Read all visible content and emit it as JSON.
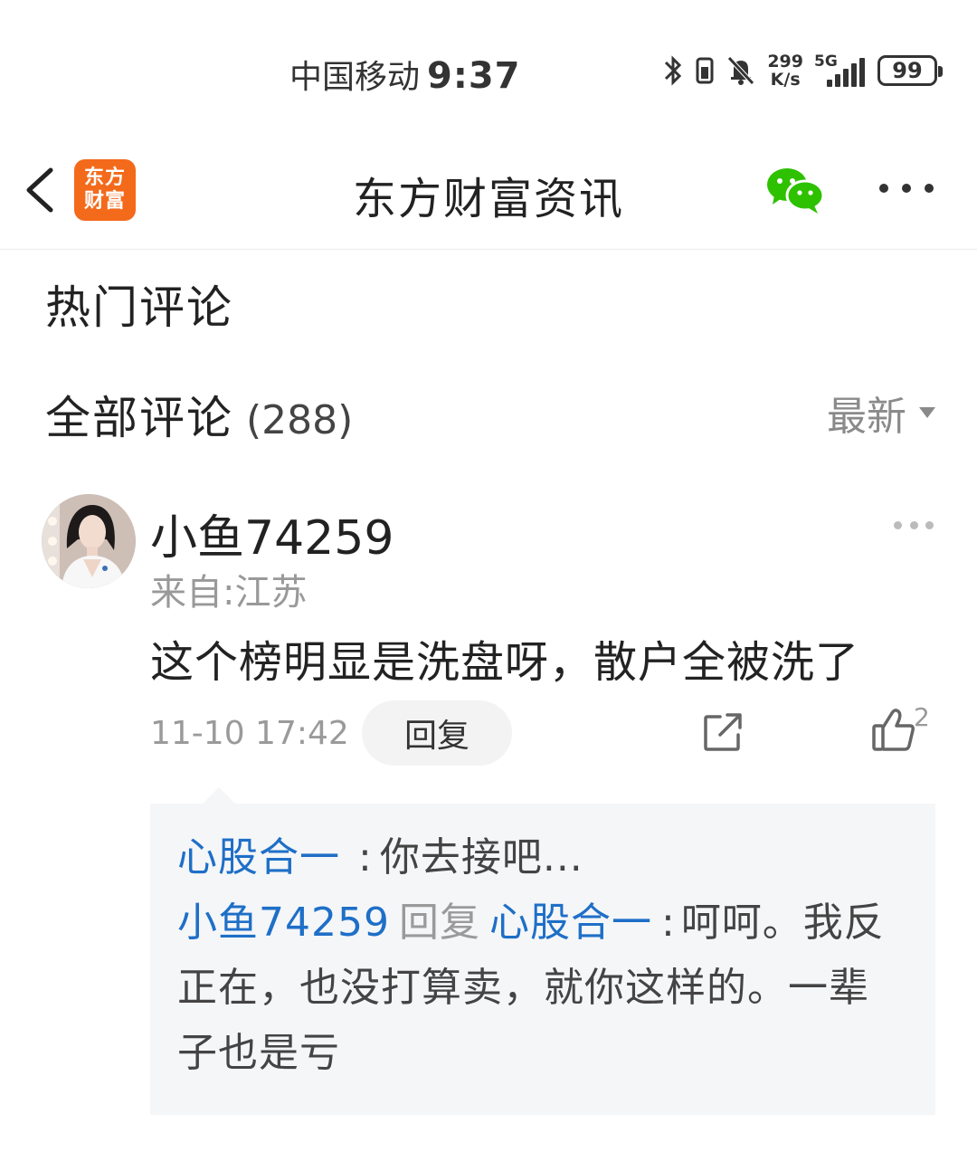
{
  "status_bar": {
    "carrier": "中国移动",
    "time": "9:37",
    "net_speed_value": "299",
    "net_speed_unit": "K/s",
    "signal_type": "5G",
    "battery": "99"
  },
  "nav": {
    "logo_line1": "东方",
    "logo_line2": "财富",
    "title": "东方财富资讯"
  },
  "sections": {
    "hot_comments": "热门评论",
    "all_comments": "全部评论",
    "all_count": "(288)",
    "sort_label": "最新"
  },
  "comment": {
    "user": "小鱼74259",
    "location": "来自:江苏",
    "text": "这个榜明显是洗盘呀，散户全被洗了",
    "time": "11-10 17:42",
    "reply_button": "回复",
    "like_count": "2",
    "replies": [
      {
        "from": "心股合一",
        "separator": ":",
        "text": "你去接吧..."
      },
      {
        "from": "小鱼74259",
        "reply_word": "回复",
        "to": "心股合一",
        "separator": ":",
        "text": "呵呵。我反正在，也没打算卖，就你这样的。一辈子也是亏"
      }
    ]
  },
  "colors": {
    "brand_orange": "#f36a1b",
    "link_blue": "#1e6fc7",
    "wechat_green": "#2dc100"
  }
}
